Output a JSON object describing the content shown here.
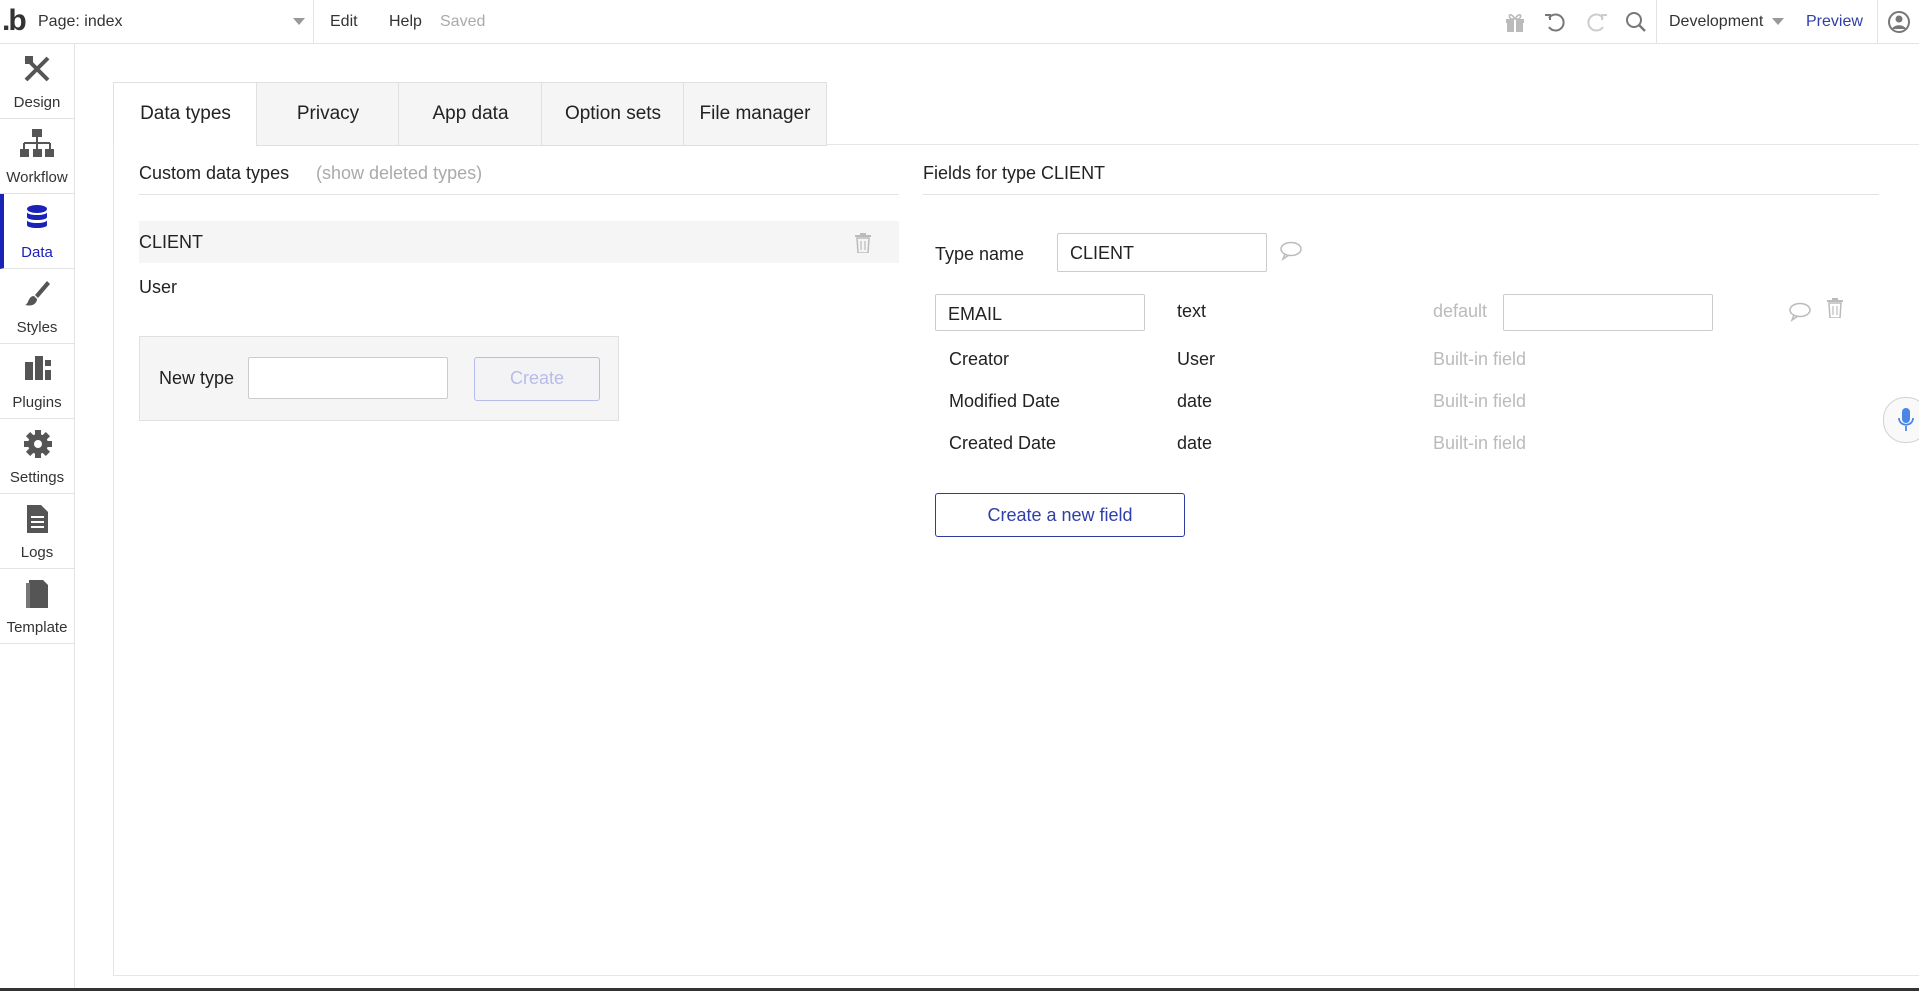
{
  "topbar": {
    "logo": ".b",
    "page_label": "Page: index",
    "menu": {
      "edit": "Edit",
      "help": "Help"
    },
    "status": "Saved",
    "environment": "Development",
    "preview": "Preview"
  },
  "sidebar": {
    "items": [
      {
        "label": "Design",
        "icon": "design-icon"
      },
      {
        "label": "Workflow",
        "icon": "workflow-icon"
      },
      {
        "label": "Data",
        "icon": "database-icon",
        "active": true
      },
      {
        "label": "Styles",
        "icon": "brush-icon"
      },
      {
        "label": "Plugins",
        "icon": "plugin-icon"
      },
      {
        "label": "Settings",
        "icon": "gear-icon"
      },
      {
        "label": "Logs",
        "icon": "document-icon"
      },
      {
        "label": "Template",
        "icon": "template-icon"
      }
    ]
  },
  "tabs": [
    "Data types",
    "Privacy",
    "App data",
    "Option sets",
    "File manager"
  ],
  "data_types": {
    "title": "Custom data types",
    "show_deleted": "(show deleted types)",
    "types": [
      "CLIENT",
      "User"
    ],
    "new_type_label": "New type",
    "new_type_value": "",
    "create_label": "Create"
  },
  "fields_panel": {
    "title": "Fields for type CLIENT",
    "type_name_label": "Type name",
    "type_name_value": "CLIENT",
    "editable_field": {
      "name": "EMAIL",
      "type": "text",
      "default_label": "default",
      "default_value": ""
    },
    "builtin_fields": [
      {
        "name": "Creator",
        "type": "User",
        "note": "Built-in field"
      },
      {
        "name": "Modified Date",
        "type": "date",
        "note": "Built-in field"
      },
      {
        "name": "Created Date",
        "type": "date",
        "note": "Built-in field"
      }
    ],
    "create_field_label": "Create a new field"
  },
  "colors": {
    "accent": "#1a22b8",
    "link": "#2f3ea8"
  }
}
